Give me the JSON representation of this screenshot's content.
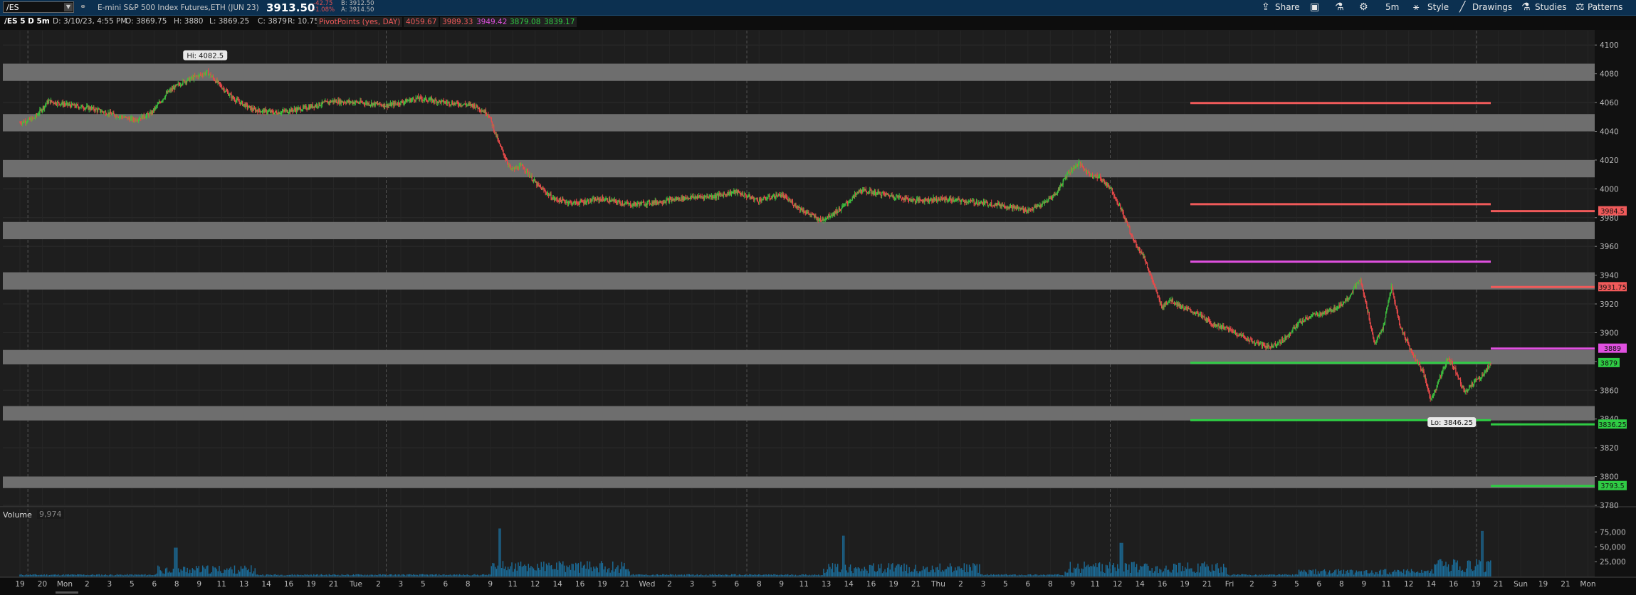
{
  "header": {
    "symbol": "/ES",
    "description": "E-mini S&P 500 Index Futures,ETH (JUN 23)",
    "last_price": "3913.50",
    "net_change": "-42.75",
    "pct_change": "-1.08%",
    "bid": "B: 3912.50",
    "ask": "A: 3914.50",
    "share_label": "Share",
    "timeframe_label": "5m",
    "style_label": "Style",
    "drawings_label": "Drawings",
    "studies_label": "Studies",
    "patterns_label": "Patterns"
  },
  "info_bar": {
    "symbol_period": "/ES 5 D 5m",
    "date": "D: 3/10/23, 4:55 PM",
    "open": "O: 3869.75",
    "high": "H: 3880",
    "low": "L: 3869.25",
    "close": "C: 3879",
    "range": "R: 10.75",
    "study_name": "PivotPoints (yes, DAY)",
    "study_values": [
      "4059.67",
      "3989.33",
      "3949.42",
      "3879.08",
      "3839.17"
    ]
  },
  "colors": {
    "up": "#3fbf3f",
    "down": "#e84a4a",
    "resistance": "#f05a5a",
    "pivot": "#e050e0",
    "support": "#2fcc44",
    "zone": "#6e6e6e",
    "volume": "#1b6d9a"
  },
  "chart_data": {
    "type": "candlestick",
    "y_range": [
      3780,
      4110
    ],
    "y_ticks": [
      "4100",
      "4080",
      "4060",
      "4040",
      "4020",
      "4000",
      "3980",
      "3960",
      "3940",
      "3920",
      "3900",
      "3880",
      "3860",
      "3840",
      "3820",
      "3800",
      "3780"
    ],
    "x_ticks": [
      "19",
      "20",
      "Mon",
      "2",
      "3",
      "5",
      "6",
      "8",
      "9",
      "11",
      "13",
      "14",
      "16",
      "19",
      "21",
      "Tue",
      "2",
      "3",
      "5",
      "6",
      "8",
      "9",
      "11",
      "12",
      "14",
      "16",
      "19",
      "21",
      "Wed",
      "2",
      "3",
      "5",
      "6",
      "8",
      "9",
      "11",
      "13",
      "14",
      "16",
      "19",
      "21",
      "Thu",
      "2",
      "3",
      "5",
      "6",
      "8",
      "9",
      "11",
      "12",
      "14",
      "16",
      "19",
      "21",
      "Fri",
      "2",
      "3",
      "5",
      "6",
      "8",
      "9",
      "11",
      "12",
      "14",
      "16",
      "19",
      "21",
      "Sun",
      "19",
      "21",
      "Mon"
    ],
    "price_path": [
      [
        0,
        4046
      ],
      [
        0.5,
        4049
      ],
      [
        1,
        4061
      ],
      [
        1.8,
        4058
      ],
      [
        2.5,
        4056
      ],
      [
        3.2,
        4052
      ],
      [
        4,
        4048
      ],
      [
        4.6,
        4052
      ],
      [
        5.2,
        4067
      ],
      [
        5.7,
        4074
      ],
      [
        6.2,
        4078
      ],
      [
        6.6,
        4081
      ],
      [
        7,
        4073
      ],
      [
        7.5,
        4063
      ],
      [
        8.2,
        4055
      ],
      [
        9,
        4053
      ],
      [
        10,
        4056
      ],
      [
        11,
        4061
      ],
      [
        12,
        4060
      ],
      [
        13,
        4058
      ],
      [
        14,
        4063
      ],
      [
        15,
        4060
      ],
      [
        16,
        4058
      ],
      [
        16.5,
        4052
      ],
      [
        16.9,
        4030
      ],
      [
        17.3,
        4013
      ],
      [
        17.7,
        4016
      ],
      [
        18.2,
        4003
      ],
      [
        18.8,
        3993
      ],
      [
        19.5,
        3990
      ],
      [
        20.5,
        3993
      ],
      [
        21.5,
        3989
      ],
      [
        22.5,
        3991
      ],
      [
        23.5,
        3994
      ],
      [
        24.5,
        3995
      ],
      [
        25.2,
        3998
      ],
      [
        26,
        3992
      ],
      [
        26.8,
        3996
      ],
      [
        27.5,
        3986
      ],
      [
        28.2,
        3978
      ],
      [
        28.9,
        3986
      ],
      [
        29.6,
        3999
      ],
      [
        30.5,
        3996
      ],
      [
        31.5,
        3992
      ],
      [
        32.5,
        3993
      ],
      [
        33.5,
        3991
      ],
      [
        34.5,
        3989
      ],
      [
        35.5,
        3985
      ],
      [
        36,
        3989
      ],
      [
        36.5,
        3997
      ],
      [
        36.9,
        4011
      ],
      [
        37.3,
        4018
      ],
      [
        37.6,
        4011
      ],
      [
        38,
        4008
      ],
      [
        38.4,
        4001
      ],
      [
        38.8,
        3985
      ],
      [
        39.2,
        3965
      ],
      [
        39.6,
        3952
      ],
      [
        39.9,
        3935
      ],
      [
        40.2,
        3918
      ],
      [
        40.5,
        3923
      ],
      [
        41,
        3917
      ],
      [
        41.5,
        3913
      ],
      [
        42,
        3906
      ],
      [
        42.5,
        3903
      ],
      [
        43,
        3898
      ],
      [
        43.5,
        3893
      ],
      [
        44,
        3890
      ],
      [
        44.5,
        3895
      ],
      [
        45,
        3906
      ],
      [
        45.5,
        3912
      ],
      [
        46,
        3914
      ],
      [
        46.5,
        3919
      ],
      [
        46.8,
        3925
      ],
      [
        47.2,
        3937
      ],
      [
        47.5,
        3912
      ],
      [
        47.7,
        3892
      ],
      [
        48,
        3903
      ],
      [
        48.3,
        3932
      ],
      [
        48.6,
        3905
      ],
      [
        49,
        3887
      ],
      [
        49.4,
        3873
      ],
      [
        49.7,
        3853
      ],
      [
        50,
        3868
      ],
      [
        50.3,
        3883
      ],
      [
        50.6,
        3872
      ],
      [
        50.9,
        3858
      ],
      [
        51.2,
        3866
      ],
      [
        51.5,
        3870
      ],
      [
        51.8,
        3879
      ]
    ],
    "hi_label": "Hi: 4082.5",
    "lo_label": "Lo: 3846.25",
    "zones": [
      [
        4075,
        4087
      ],
      [
        4040,
        4052
      ],
      [
        4008,
        4020
      ],
      [
        3965,
        3977
      ],
      [
        3930,
        3942
      ],
      [
        3878,
        3888
      ],
      [
        3839,
        3849
      ],
      [
        3792,
        3800
      ]
    ],
    "pivot_levels": [
      {
        "name": "R2",
        "value": 4059.67,
        "color": "resistance",
        "session": "current"
      },
      {
        "name": "R1",
        "value": 3989.33,
        "color": "resistance",
        "session": "current"
      },
      {
        "name": "PP",
        "value": 3949.42,
        "color": "pivot",
        "session": "current"
      },
      {
        "name": "S1",
        "value": 3879.08,
        "color": "support",
        "session": "current"
      },
      {
        "name": "S2",
        "value": 3839.17,
        "color": "support",
        "session": "current"
      },
      {
        "name": "R1n",
        "value": 3984.5,
        "color": "resistance",
        "session": "next",
        "label": "3984.5"
      },
      {
        "name": "PPr",
        "value": 3931.75,
        "color": "resistance",
        "session": "next",
        "label": "3931.75"
      },
      {
        "name": "PPn",
        "value": 3889,
        "color": "pivot",
        "session": "next",
        "label": "3889"
      },
      {
        "name": "S1n",
        "value": 3836.25,
        "color": "support",
        "session": "next",
        "label": "3836.25"
      },
      {
        "name": "S2n",
        "value": 3793.5,
        "color": "support",
        "session": "next",
        "label": "3793.5"
      }
    ],
    "last_price_label": "3879",
    "volume": {
      "title": "Volume",
      "count": "9,974",
      "y_ticks": [
        "75,000",
        "50,000",
        "25,000"
      ],
      "y_range": [
        0,
        90000
      ]
    }
  }
}
